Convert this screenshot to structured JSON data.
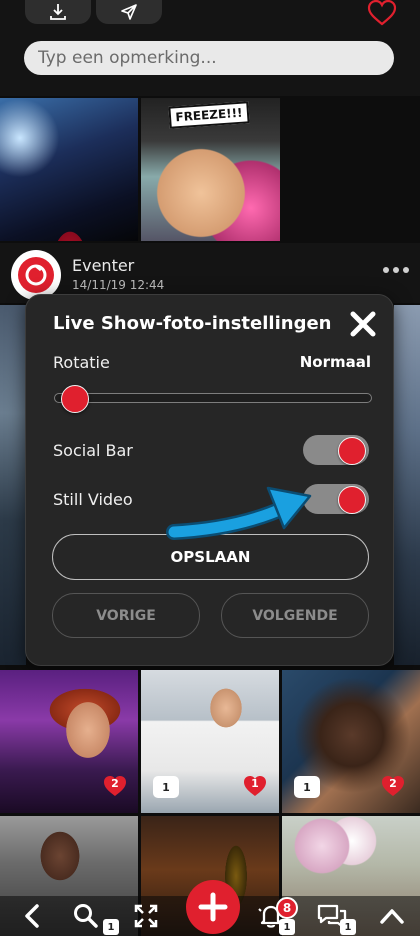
{
  "comment_input": {
    "placeholder": "Typ een opmerking..."
  },
  "post": {
    "user": "Eventer",
    "date": "14/11/19 12:44"
  },
  "photos_top": {
    "freeze_sign": "FREEZE!!!"
  },
  "dialog": {
    "title": "Live Show-foto-instellingen",
    "rotation_label": "Rotatie",
    "rotation_value": "Normaal",
    "rotation_level": 0.06,
    "social_bar_label": "Social Bar",
    "social_bar_on": true,
    "still_video_label": "Still Video",
    "still_video_on": true,
    "save_label": "OPSLAAN",
    "prev_label": "VORIGE",
    "next_label": "VOLGENDE"
  },
  "grid": {
    "likes": [
      "2",
      "1",
      "2"
    ],
    "comments": [
      "1",
      "1"
    ],
    "comments_row2": [
      "1",
      "1"
    ]
  },
  "bottom_nav": {
    "notification_count": "8",
    "left_badge": "1",
    "mid_badge": "1",
    "right_badge": "1"
  },
  "colors": {
    "accent": "#e0202e",
    "panel": "#262626",
    "arrow": "#1aa0e0"
  },
  "icons": [
    "download-icon",
    "send-icon",
    "heart-outline-icon",
    "close-icon",
    "back-icon",
    "search-icon",
    "fullscreen-icon",
    "plus-icon",
    "bell-icon",
    "chat-icon",
    "chevron-up-icon"
  ]
}
